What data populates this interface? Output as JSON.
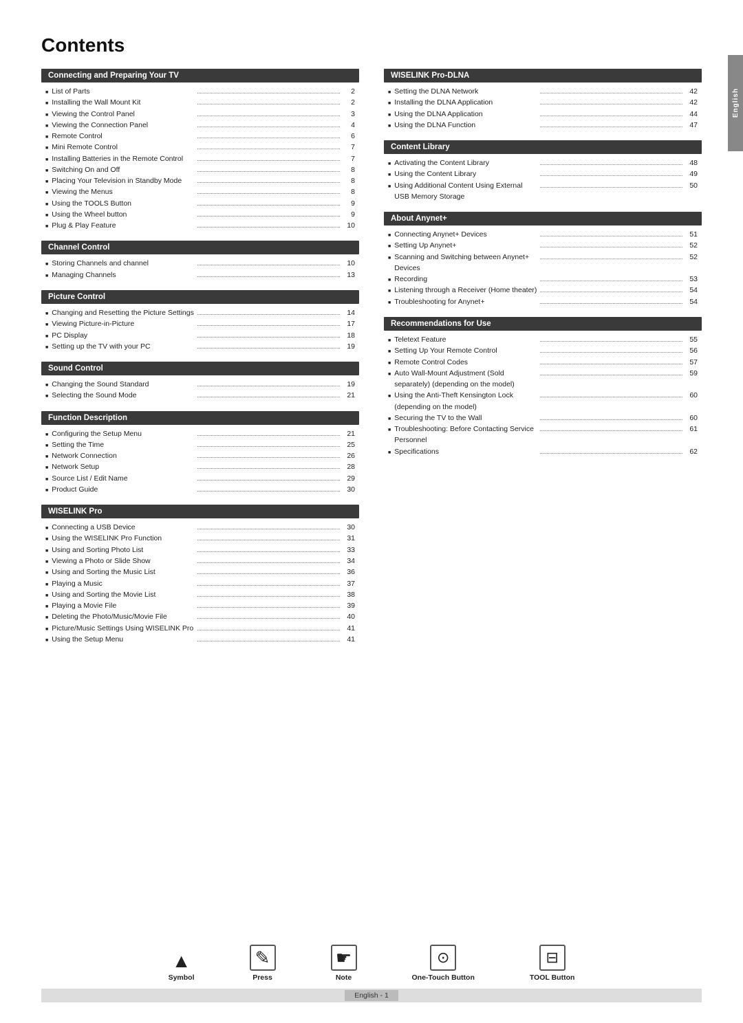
{
  "page": {
    "title": "Contents",
    "side_tab": "English",
    "footer_page": "English - 1"
  },
  "symbols": [
    {
      "id": "symbol",
      "icon": "▲",
      "label": "Symbol",
      "sublabel": ""
    },
    {
      "id": "press",
      "icon": "✎",
      "label": "Press",
      "sublabel": ""
    },
    {
      "id": "note",
      "icon": "✋",
      "label": "Note",
      "sublabel": ""
    },
    {
      "id": "one-touch",
      "icon": "⬛",
      "label": "One-Touch Button",
      "sublabel": ""
    },
    {
      "id": "tool",
      "icon": "⊡",
      "label": "TOOL Button",
      "sublabel": ""
    }
  ],
  "left_sections": [
    {
      "id": "connecting-preparing",
      "header": "Connecting and Preparing Your TV",
      "items": [
        {
          "text": "List of Parts",
          "page": "2"
        },
        {
          "text": "Installing the Wall Mount Kit",
          "page": "2"
        },
        {
          "text": "Viewing the Control Panel",
          "page": "3"
        },
        {
          "text": "Viewing the Connection Panel",
          "page": "4"
        },
        {
          "text": "Remote Control",
          "page": "6"
        },
        {
          "text": "Mini Remote Control",
          "page": "7"
        },
        {
          "text": "Installing Batteries in the Remote Control",
          "page": "7"
        },
        {
          "text": "Switching On and Off",
          "page": "8"
        },
        {
          "text": "Placing Your Television in Standby Mode",
          "page": "8"
        },
        {
          "text": "Viewing the Menus",
          "page": "8"
        },
        {
          "text": "Using the TOOLS Button",
          "page": "9"
        },
        {
          "text": "Using the Wheel button",
          "page": "9"
        },
        {
          "text": "Plug & Play Feature",
          "page": "10"
        }
      ]
    },
    {
      "id": "channel-control",
      "header": "Channel Control",
      "items": [
        {
          "text": "Storing Channels and channel",
          "page": "10"
        },
        {
          "text": "Managing Channels",
          "page": "13"
        }
      ]
    },
    {
      "id": "picture-control",
      "header": "Picture Control",
      "items": [
        {
          "text": "Changing and Resetting the Picture Settings",
          "page": "14"
        },
        {
          "text": "Viewing Picture-in-Picture",
          "page": "17"
        },
        {
          "text": "PC Display",
          "page": "18"
        },
        {
          "text": "Setting up the TV with your PC",
          "page": "19"
        }
      ]
    },
    {
      "id": "sound-control",
      "header": "Sound Control",
      "items": [
        {
          "text": "Changing the Sound Standard",
          "page": "19"
        },
        {
          "text": "Selecting the Sound Mode",
          "page": "21"
        }
      ]
    },
    {
      "id": "function-description",
      "header": "Function Description",
      "items": [
        {
          "text": "Configuring the Setup Menu",
          "page": "21"
        },
        {
          "text": "Setting the Time",
          "page": "25"
        },
        {
          "text": "Network Connection",
          "page": "26"
        },
        {
          "text": "Network Setup",
          "page": "28"
        },
        {
          "text": "Source List / Edit Name",
          "page": "29"
        },
        {
          "text": "Product Guide",
          "page": "30"
        }
      ]
    },
    {
      "id": "wiselink-pro",
      "header": "WISELINK Pro",
      "items": [
        {
          "text": "Connecting a USB Device",
          "page": "30"
        },
        {
          "text": "Using the WISELINK Pro Function",
          "page": "31"
        },
        {
          "text": "Using and Sorting Photo List",
          "page": "33"
        },
        {
          "text": "Viewing a Photo or Slide Show",
          "page": "34"
        },
        {
          "text": "Using and Sorting the Music List",
          "page": "36"
        },
        {
          "text": "Playing a Music",
          "page": "37"
        },
        {
          "text": "Using and Sorting the Movie List",
          "page": "38"
        },
        {
          "text": "Playing a Movie File",
          "page": "39"
        },
        {
          "text": "Deleting the Photo/Music/Movie File",
          "page": "40"
        },
        {
          "text": "Picture/Music Settings Using WISELINK Pro",
          "page": "41"
        },
        {
          "text": "Using the Setup Menu",
          "page": "41"
        }
      ]
    }
  ],
  "right_sections": [
    {
      "id": "wiselink-pro-dlna",
      "header": "WISELINK Pro-DLNA",
      "items": [
        {
          "text": "Setting the DLNA Network",
          "page": "42"
        },
        {
          "text": "Installing the DLNA Application",
          "page": "42"
        },
        {
          "text": "Using the DLNA Application",
          "page": "44"
        },
        {
          "text": "Using the DLNA Function",
          "page": "47"
        }
      ]
    },
    {
      "id": "content-library",
      "header": "Content Library",
      "items": [
        {
          "text": "Activating the Content Library",
          "page": "48"
        },
        {
          "text": "Using the Content Library",
          "page": "49"
        },
        {
          "text": "Using Additional Content Using External USB Memory Storage",
          "page": "50"
        }
      ]
    },
    {
      "id": "about-anynet",
      "header": "About Anynet+",
      "items": [
        {
          "text": "Connecting Anynet+ Devices",
          "page": "51"
        },
        {
          "text": "Setting Up Anynet+",
          "page": "52"
        },
        {
          "text": "Scanning and Switching between Anynet+ Devices",
          "page": "52"
        },
        {
          "text": "Recording",
          "page": "53"
        },
        {
          "text": "Listening through a Receiver (Home theater)",
          "page": "54"
        },
        {
          "text": "Troubleshooting for Anynet+",
          "page": "54"
        }
      ]
    },
    {
      "id": "recommendations",
      "header": "Recommendations for Use",
      "items": [
        {
          "text": "Teletext Feature",
          "page": "55"
        },
        {
          "text": "Setting Up Your Remote Control",
          "page": "56"
        },
        {
          "text": "Remote Control Codes",
          "page": "57"
        },
        {
          "text": "Auto Wall-Mount Adjustment (Sold separately) (depending on the model)",
          "page": "59"
        },
        {
          "text": "Using the Anti-Theft Kensington Lock (depending on the model)",
          "page": "60"
        },
        {
          "text": "Securing the TV to the Wall",
          "page": "60"
        },
        {
          "text": "Troubleshooting: Before Contacting Service Personnel",
          "page": "61"
        },
        {
          "text": "Specifications",
          "page": "62"
        }
      ]
    }
  ]
}
